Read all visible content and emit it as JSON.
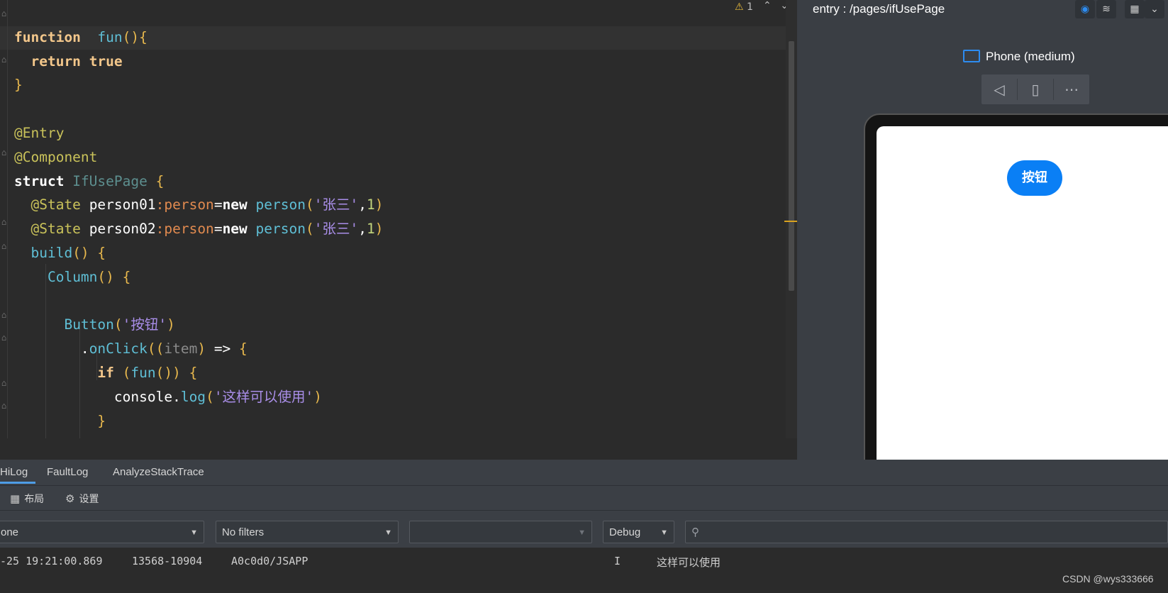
{
  "editor": {
    "warning_count": "1",
    "code": {
      "l1": {
        "kw": "function",
        "name": "fun",
        "paren": "()",
        "brace": "{"
      },
      "l2": {
        "kw": "return",
        "val": "true"
      },
      "l3": {
        "brace": "}"
      },
      "l5": "@Entry",
      "l6": "@Component",
      "l7": {
        "kw": "struct",
        "name": "IfUsePage",
        "brace": "{"
      },
      "l8": {
        "ann": "@State",
        "var": "person01",
        "colon": ":",
        "type": "person",
        "eq": "=",
        "new": "new",
        "cls": "person",
        "lp": "(",
        "str": "'张三'",
        "comma": ",",
        "num": "1",
        "rp": ")"
      },
      "l9": {
        "ann": "@State",
        "var": "person02",
        "colon": ":",
        "type": "person",
        "eq": "=",
        "new": "new",
        "cls": "person",
        "lp": "(",
        "str": "'张三'",
        "comma": ",",
        "num": "1",
        "rp": ")"
      },
      "l10": {
        "fn": "build",
        "paren": "()",
        "brace": "{"
      },
      "l11": {
        "fn": "Column",
        "paren": "()",
        "brace": "{"
      },
      "l13": {
        "fn": "Button",
        "lp": "(",
        "str": "'按钮'",
        "rp": ")"
      },
      "l14": {
        "dot": ".",
        "fn": "onClick",
        "lp": "((",
        "param": "item",
        "rp": ")",
        "arrow": "=>",
        "brace": "{"
      },
      "l15": {
        "kw": "if",
        "lp": "(",
        "fn": "fun",
        "call": "())",
        "brace": "{"
      },
      "l16": {
        "obj": "console",
        "dot": ".",
        "fn": "log",
        "lp": "(",
        "str": "'这样可以使用'",
        "rp": ")"
      },
      "l17": {
        "brace": "}"
      },
      "l18": {
        "brace": "})"
      }
    }
  },
  "preview": {
    "title": "entry : /pages/ifUsePage",
    "device_name": "Phone (medium)",
    "app_button_label": "按钮"
  },
  "bottom": {
    "tabs": [
      "HiLog",
      "FaultLog",
      "AnalyzeStackTrace"
    ],
    "tools": {
      "layout": "布局",
      "settings": "设置"
    },
    "filters": {
      "device": "one",
      "filter": "No filters",
      "empty": "",
      "level": "Debug"
    },
    "log": {
      "time": "-25 19:21:00.869",
      "pid": "13568-10904",
      "tag": "A0c0d0/JSAPP",
      "level": "I",
      "message": "这样可以使用"
    }
  },
  "watermark": "CSDN @wys333666",
  "icons": {
    "fold": "fold-marker-icon",
    "warning": "warning-icon",
    "back": "back-triangle-icon",
    "rotate": "rotate-device-icon",
    "more": "more-dots-icon",
    "layout": "grid-layout-icon",
    "settings": "gear-icon",
    "search": "search-icon"
  }
}
